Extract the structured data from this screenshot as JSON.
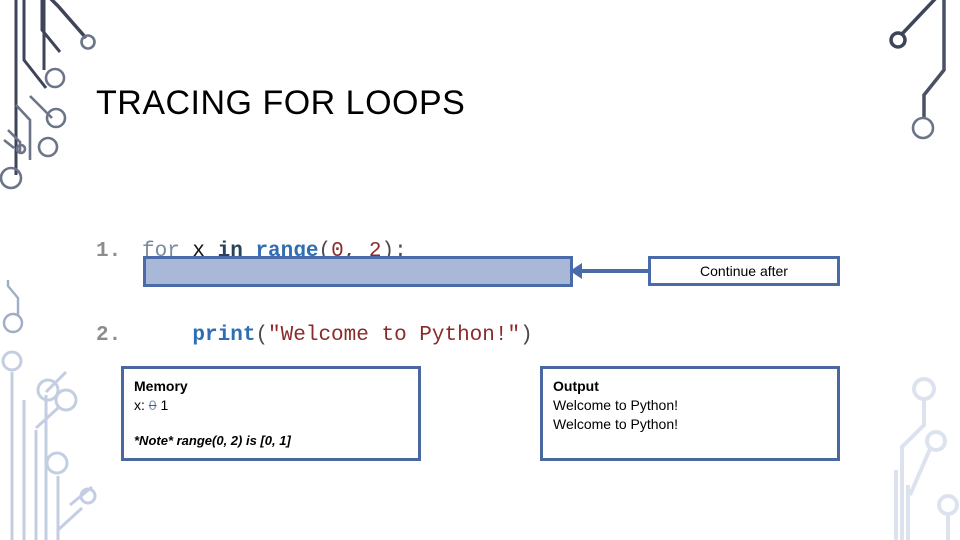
{
  "slide": {
    "title": "TRACING FOR LOOPS",
    "background_color": "#ffffff"
  },
  "code": {
    "language": "python",
    "lines": [
      {
        "number": "1.",
        "tokens": [
          {
            "text": "for ",
            "kind": "keyword-for"
          },
          {
            "text": "x ",
            "kind": "identifier"
          },
          {
            "text": "in ",
            "kind": "keyword-in"
          },
          {
            "text": "range",
            "kind": "function"
          },
          {
            "text": "(",
            "kind": "punctuation"
          },
          {
            "text": "0",
            "kind": "number"
          },
          {
            "text": ", ",
            "kind": "punctuation"
          },
          {
            "text": "2",
            "kind": "number"
          },
          {
            "text": "):",
            "kind": "punctuation"
          }
        ]
      },
      {
        "number": "2.",
        "tokens": [
          {
            "text": "    ",
            "kind": "punctuation"
          },
          {
            "text": "print",
            "kind": "function"
          },
          {
            "text": "(",
            "kind": "punctuation"
          },
          {
            "text": "\"Welcome to Python!\"",
            "kind": "string"
          },
          {
            "text": ")",
            "kind": "punctuation"
          }
        ]
      }
    ]
  },
  "highlight_bar": {
    "fill_color": "#a8b8d6",
    "border_color": "#4a6aaa"
  },
  "callout": {
    "label": "Continue after",
    "border_color": "#4a6aaa",
    "arrow_color": "#4a6aaa"
  },
  "memory_panel": {
    "title": "Memory",
    "variable_label": "x:",
    "old_value": "0",
    "current_value": "1",
    "note": "*Note* range(0, 2) is [0, 1]",
    "border_color": "#49689f"
  },
  "output_panel": {
    "title": "Output",
    "lines": [
      "Welcome to Python!",
      "Welcome to Python!"
    ],
    "border_color": "#49689f"
  },
  "decoration": {
    "top_left": "circuit-trace-dark",
    "bottom_left": "circuit-trace-light",
    "top_right": "circuit-trace-dark",
    "bottom_right": "circuit-trace-light",
    "dark_color": "#3f4558",
    "mid_color": "#6b7488",
    "light_color": "#dde3ee"
  }
}
